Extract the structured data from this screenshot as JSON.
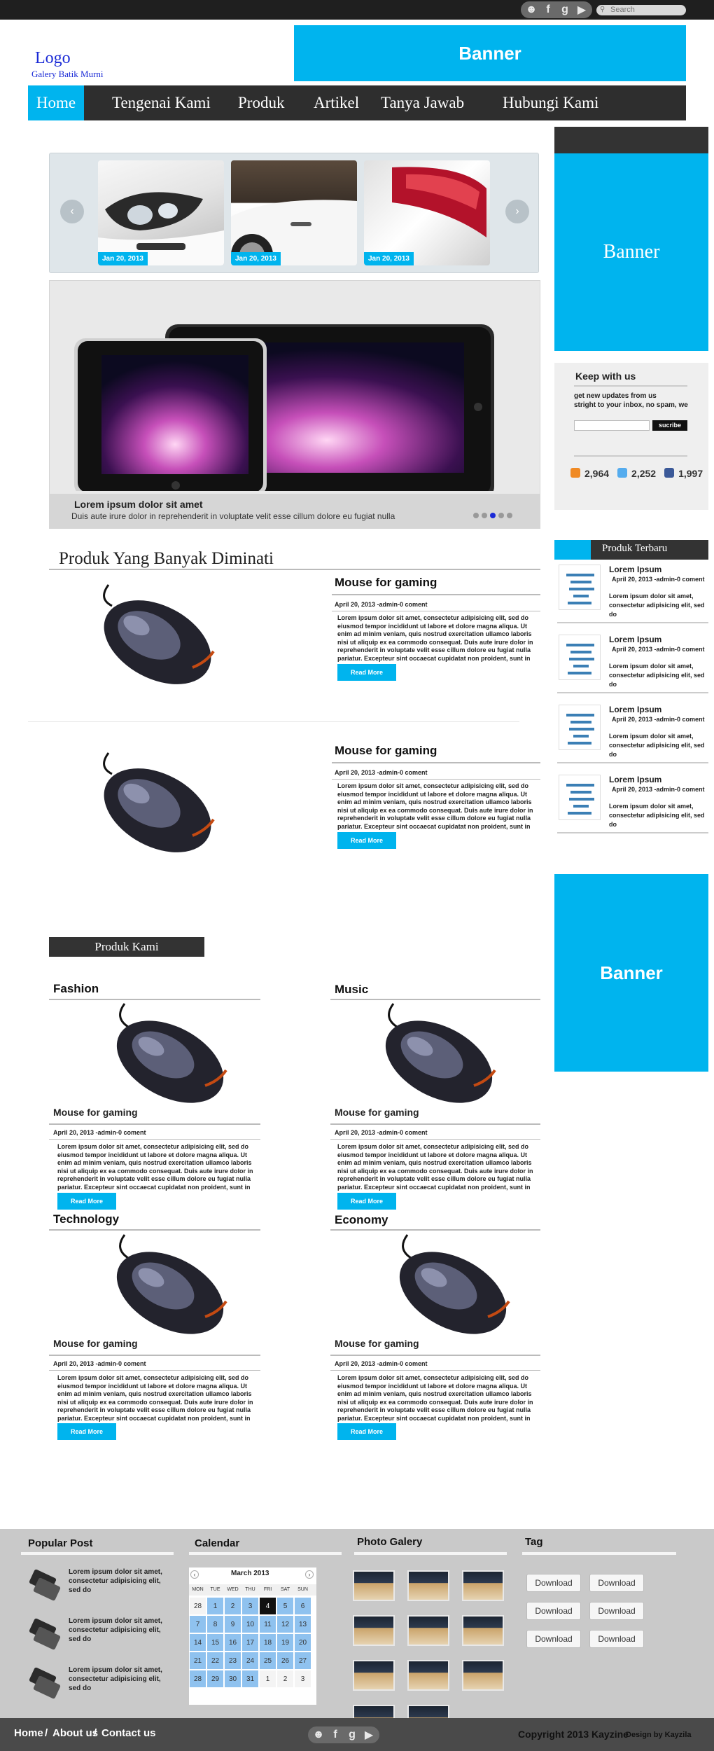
{
  "header": {
    "logo": "Logo",
    "logo_sub": "Galery Batik Murni",
    "banner": "Banner",
    "search_placeholder": "Search",
    "social_icons": [
      "people-icon",
      "facebook-icon",
      "googleplus-icon",
      "play-icon"
    ]
  },
  "nav": {
    "items": [
      "Home",
      "Tengenai Kami",
      "Produk",
      "Artikel",
      "Tanya Jawab",
      "Hubungi Kami"
    ]
  },
  "slider": {
    "dates": [
      "Jan 20, 2013",
      "Jan 20, 2013",
      "Jan 20, 2013"
    ],
    "prev": "‹",
    "next": "›"
  },
  "feature": {
    "title": "Lorem ipsum dolor sit amet",
    "text": "Duis aute irure dolor in reprehenderit in voluptate velit esse cillum dolore eu fugiat nulla"
  },
  "popular": {
    "section_title": "Produk Yang Banyak Diminati",
    "items": [
      {
        "title": "Mouse for gaming",
        "meta": "April 20, 2013 -admin-0 coment",
        "text": "Lorem ipsum dolor sit amet, consectetur adipisicing elit, sed do eiusmod tempor incididunt ut labore et dolore magna aliqua. Ut enim ad minim veniam, quis nostrud exercitation ullamco laboris nisi ut aliquip ex ea commodo consequat. Duis aute irure dolor in reprehenderit in voluptate velit esse cillum dolore eu fugiat nulla pariatur. Excepteur sint occaecat cupidatat non proident, sunt in",
        "button": "Read More"
      },
      {
        "title": "Mouse for gaming",
        "meta": "April 20, 2013 -admin-0 coment",
        "text": "Lorem ipsum dolor sit amet, consectetur adipisicing elit, sed do eiusmod tempor incididunt ut labore et dolore magna aliqua. Ut enim ad minim veniam, quis nostrud exercitation ullamco laboris nisi ut aliquip ex ea commodo consequat. Duis aute irure dolor in reprehenderit in voluptate velit esse cillum dolore eu fugiat nulla pariatur. Excepteur sint occaecat cupidatat non proident, sunt in",
        "button": "Read More"
      }
    ]
  },
  "produk_kami": {
    "label": "Produk Kami",
    "categories": [
      {
        "category": "Fashion",
        "title": "Mouse for gaming",
        "meta": "April 20, 2013 -admin-0 coment",
        "text": "Lorem ipsum dolor sit amet, consectetur adipisicing elit, sed do eiusmod tempor incididunt ut labore et dolore magna aliqua. Ut enim ad minim veniam, quis nostrud exercitation ullamco laboris nisi ut aliquip ex ea commodo consequat. Duis aute irure dolor in reprehenderit in voluptate velit esse cillum dolore eu fugiat nulla pariatur. Excepteur sint occaecat cupidatat non proident, sunt in",
        "button": "Read More"
      },
      {
        "category": "Music",
        "title": "Mouse for gaming",
        "meta": "April 20, 2013 -admin-0 coment",
        "text": "Lorem ipsum dolor sit amet, consectetur adipisicing elit, sed do eiusmod tempor incididunt ut labore et dolore magna aliqua. Ut enim ad minim veniam, quis nostrud exercitation ullamco laboris nisi ut aliquip ex ea commodo consequat. Duis aute irure dolor in reprehenderit in voluptate velit esse cillum dolore eu fugiat nulla pariatur. Excepteur sint occaecat cupidatat non proident, sunt in",
        "button": "Read More"
      },
      {
        "category": "Technology",
        "title": "Mouse for gaming",
        "meta": "April 20, 2013 -admin-0 coment",
        "text": "Lorem ipsum dolor sit amet, consectetur adipisicing elit, sed do eiusmod tempor incididunt ut labore et dolore magna aliqua. Ut enim ad minim veniam, quis nostrud exercitation ullamco laboris nisi ut aliquip ex ea commodo consequat. Duis aute irure dolor in reprehenderit in voluptate velit esse cillum dolore eu fugiat nulla pariatur. Excepteur sint occaecat cupidatat non proident, sunt in",
        "button": "Read More"
      },
      {
        "category": "Economy",
        "title": "Mouse for gaming",
        "meta": "April 20, 2013 -admin-0 coment",
        "text": "Lorem ipsum dolor sit amet, consectetur adipisicing elit, sed do eiusmod tempor incididunt ut labore et dolore magna aliqua. Ut enim ad minim veniam, quis nostrud exercitation ullamco laboris nisi ut aliquip ex ea commodo consequat. Duis aute irure dolor in reprehenderit in voluptate velit esse cillum dolore eu fugiat nulla pariatur. Excepteur sint occaecat cupidatat non proident, sunt in",
        "button": "Read More"
      }
    ]
  },
  "sidebar": {
    "banner": "Banner",
    "keep_title": "Keep with us",
    "keep_text_1": "get new updates from us",
    "keep_text_2": "stright to your inbox, no spam, we",
    "subscribe": "sucribe",
    "stats": [
      {
        "icon": "rss-icon",
        "value": "2,964"
      },
      {
        "icon": "twitter-icon",
        "value": "2,252"
      },
      {
        "icon": "facebook-icon",
        "value": "1,997"
      }
    ],
    "produk_terbaru_label": "Produk Terbaru",
    "terbaru": [
      {
        "title": "Lorem Ipsum",
        "meta": "April 20, 2013 -admin-0 coment",
        "text": "Lorem ipsum dolor sit amet, consectetur adipisicing elit, sed do"
      },
      {
        "title": "Lorem Ipsum",
        "meta": "April 20, 2013 -admin-0 coment",
        "text": "Lorem ipsum dolor sit amet, consectetur adipisicing elit, sed do"
      },
      {
        "title": "Lorem Ipsum",
        "meta": "April 20, 2013 -admin-0 coment",
        "text": "Lorem ipsum dolor sit amet, consectetur adipisicing elit, sed do"
      },
      {
        "title": "Lorem Ipsum",
        "meta": "April 20, 2013 -admin-0 coment",
        "text": "Lorem ipsum dolor sit amet, consectetur adipisicing elit, sed do"
      }
    ],
    "banner2": "Banner"
  },
  "footer": {
    "popular_head": "Popular Post",
    "popular_items": [
      "Lorem ipsum dolor sit amet, consectetur adipisicing elit, sed do",
      "Lorem ipsum dolor sit amet, consectetur adipisicing elit, sed do",
      "Lorem ipsum dolor sit amet, consectetur adipisicing elit, sed do"
    ],
    "calendar_head": "Calendar",
    "calendar": {
      "month": "March 2013",
      "days": [
        "MON",
        "TUE",
        "WED",
        "THU",
        "FRI",
        "SAT",
        "SUN"
      ],
      "rows": [
        [
          "28",
          "1",
          "2",
          "3",
          "4",
          "5",
          "6"
        ],
        [
          "7",
          "8",
          "9",
          "10",
          "11",
          "12",
          "13"
        ],
        [
          "14",
          "15",
          "16",
          "17",
          "18",
          "19",
          "20"
        ],
        [
          "21",
          "22",
          "23",
          "24",
          "25",
          "26",
          "27"
        ],
        [
          "28",
          "29",
          "30",
          "31",
          "1",
          "2",
          "3"
        ]
      ],
      "today": "4"
    },
    "gallery_head": "Photo Galery",
    "tag_head": "Tag",
    "tags": [
      "Download",
      "Download",
      "Download",
      "Download",
      "Download",
      "Download"
    ],
    "links": [
      "Home",
      "About us",
      "Contact us"
    ],
    "copyright": "Copyright  2013 Kayzine",
    "design_by": "Design by Kayzila"
  },
  "colors": {
    "accent": "#00b4ee",
    "dark": "#2e2e2e",
    "footer_bg": "#c9c9c9"
  }
}
